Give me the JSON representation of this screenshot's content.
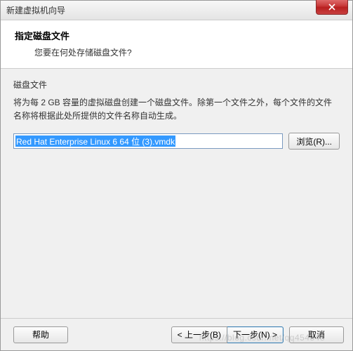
{
  "window": {
    "title": "新建虚拟机向导"
  },
  "header": {
    "title": "指定磁盘文件",
    "subtitle": "您要在何处存储磁盘文件?"
  },
  "section": {
    "label": "磁盘文件",
    "description": "将为每 2 GB 容量的虚拟磁盘创建一个磁盘文件。除第一个文件之外，每个文件的文件名称将根据此处所提供的文件名称自动生成。"
  },
  "file": {
    "value": "Red Hat Enterprise Linux 6 64 位 (3).vmdk",
    "browse_label": "浏览(R)..."
  },
  "footer": {
    "help_label": "帮助",
    "back_label": "< 上一步(B)",
    "next_label": "下一步(N) >",
    "cancel_label": "取消"
  },
  "watermark": "https://blog.csdn.net/qq454548"
}
